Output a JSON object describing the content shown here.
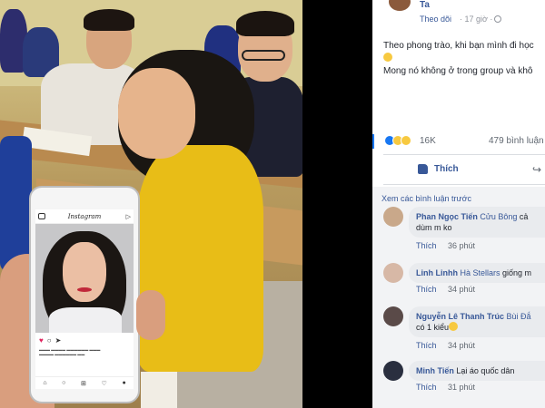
{
  "post": {
    "author": "Ta",
    "follow": "Theo dõi",
    "time": "· 17 giờ ·",
    "text_line1": "Theo phong trào, khi bạn mình đi học",
    "text_line2": "Mong nó không ở trong group và khô"
  },
  "stats": {
    "reactions": "16K",
    "comments": "479 bình luận"
  },
  "actions": {
    "like": "Thích"
  },
  "comments_section": {
    "view_previous": "Xem các bình luận trước",
    "items": [
      {
        "name": "Phan Ngọc Tiến",
        "tag": "Cửu Bông",
        "text": " cả",
        "line2": "dùm m ko",
        "reply": "Thích",
        "time": "36 phút",
        "avatar_color": "#c9a88a"
      },
      {
        "name": "Linh Linhh",
        "tag": "Hà Stellars",
        "text": " giống m",
        "line2": "",
        "reply": "Thích",
        "time": "34 phút",
        "avatar_color": "#d7b8a6"
      },
      {
        "name": "Nguyễn Lê Thanh Trúc",
        "tag": "Bùi Đắ",
        "text": "",
        "line2": "có 1 kiểu",
        "reply": "Thích",
        "time": "34 phút",
        "avatar_color": "#5a4a48"
      },
      {
        "name": "Minh Tiến",
        "tag": "",
        "text": " Lại áo quốc dân",
        "line2": "",
        "reply": "Thích",
        "time": "31 phút",
        "avatar_color": "#2a2f3f"
      }
    ]
  },
  "instagram": {
    "brand": "Instagram"
  },
  "colors": {
    "fb_blue": "#385898",
    "like_blue": "#1877f2",
    "comment_bg": "#f2f3f5"
  }
}
